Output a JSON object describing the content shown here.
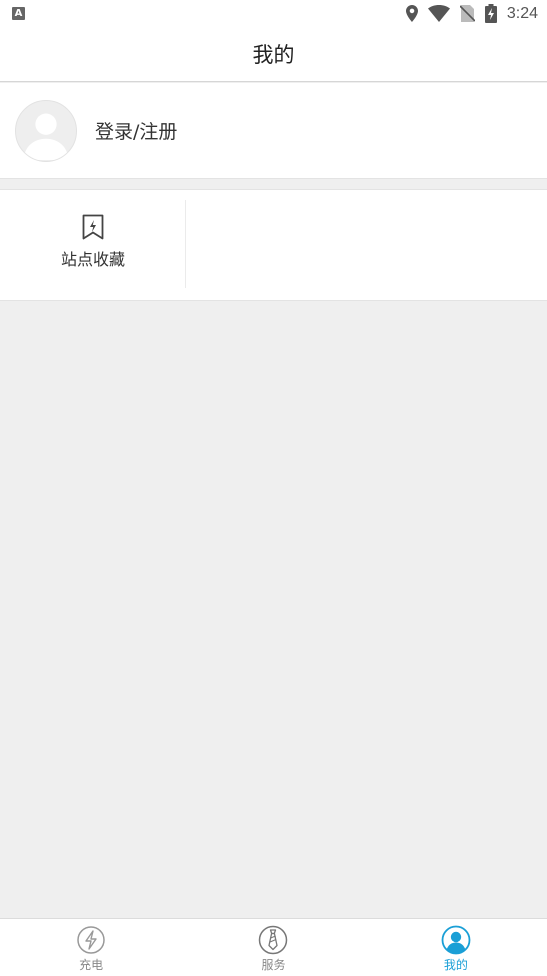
{
  "status_bar": {
    "time": "3:24",
    "app_icon_letter": "A",
    "icons": [
      "location-icon",
      "wifi-icon",
      "no-sim-icon",
      "battery-charging-icon"
    ]
  },
  "header": {
    "title": "我的"
  },
  "profile": {
    "login_label": "登录/注册",
    "avatar_icon": "default-avatar-icon"
  },
  "shortcuts": [
    {
      "label": "站点收藏",
      "icon": "bookmark-bolt-icon"
    }
  ],
  "tabs": [
    {
      "label": "充电",
      "icon": "charge-icon",
      "active": false
    },
    {
      "label": "服务",
      "icon": "tie-icon",
      "active": false
    },
    {
      "label": "我的",
      "icon": "user-icon",
      "active": true
    }
  ],
  "colors": {
    "accent": "#1a9fd6",
    "background": "#efefef",
    "inactive": "#888888"
  }
}
